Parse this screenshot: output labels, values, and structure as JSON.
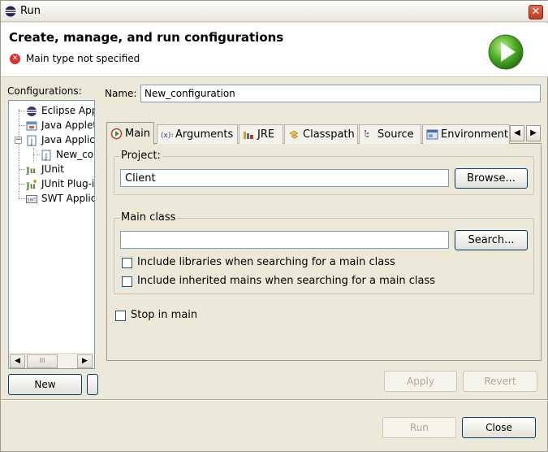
{
  "window": {
    "title": "Run",
    "close_label": "✕"
  },
  "banner": {
    "title": "Create, manage, and run configurations",
    "error_text": "Main type not specified",
    "error_icon": "error-icon",
    "run_icon": "run-play-icon"
  },
  "configurations": {
    "label": "Configurations:",
    "items": [
      {
        "label": "Eclipse App",
        "icon": "eclipse-icon"
      },
      {
        "label": "Java Applet",
        "icon": "java-applet-icon"
      },
      {
        "label": "Java Applic",
        "icon": "java-application-icon"
      },
      {
        "label": "New_co",
        "icon": "java-config-icon"
      },
      {
        "label": "JUnit",
        "icon": "junit-icon"
      },
      {
        "label": "JUnit Plug-i",
        "icon": "junit-plugin-icon"
      },
      {
        "label": "SWT Applic",
        "icon": "swt-icon"
      }
    ],
    "new_button": "New",
    "scroll_thumb": "III"
  },
  "name": {
    "label": "Name:",
    "value": "New_configuration"
  },
  "tabs": [
    {
      "label": "Main",
      "icon": "main-tab-icon"
    },
    {
      "label": "Arguments",
      "icon": "arguments-icon"
    },
    {
      "label": "JRE",
      "icon": "jre-icon"
    },
    {
      "label": "Classpath",
      "icon": "classpath-icon"
    },
    {
      "label": "Source",
      "icon": "source-icon"
    },
    {
      "label": "Environment",
      "icon": "environment-icon"
    }
  ],
  "main_tab": {
    "project_group": "Project:",
    "project_value": "Client",
    "browse_button": "Browse...",
    "main_class_group": "Main class",
    "main_class_value": "",
    "search_button": "Search...",
    "include_libraries": "Include libraries when searching for a main class",
    "include_inherited": "Include inherited mains when searching for a main class",
    "stop_in_main": "Stop in main"
  },
  "buttons": {
    "apply": "Apply",
    "revert": "Revert",
    "run": "Run",
    "close": "Close"
  }
}
